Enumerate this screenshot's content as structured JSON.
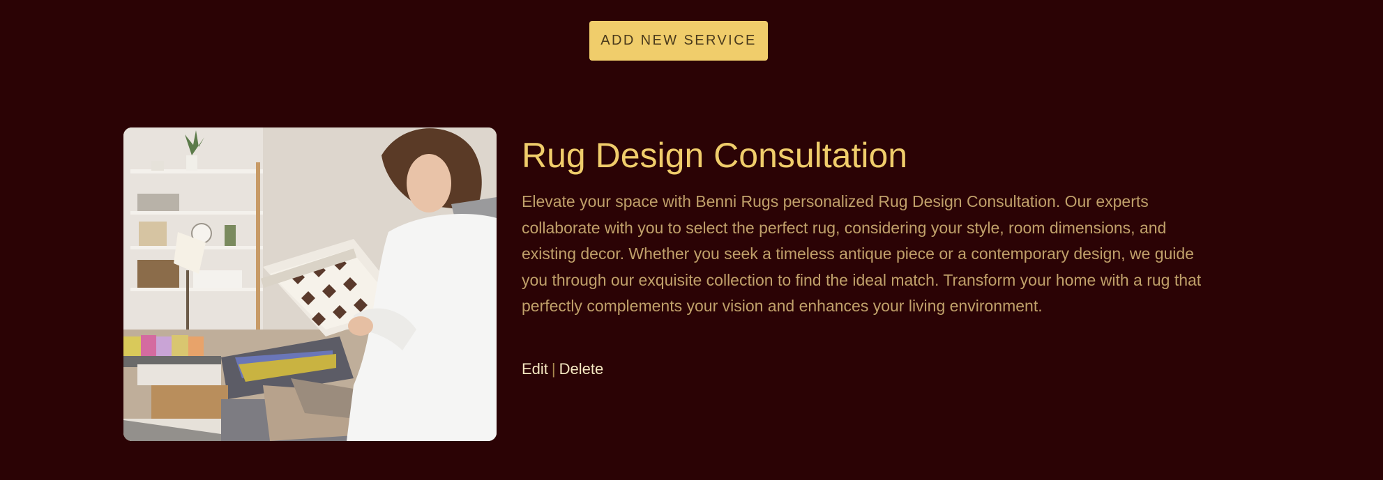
{
  "toolbar": {
    "add_service_label": "ADD NEW SERVICE"
  },
  "services": [
    {
      "title": "Rug Design Consultation",
      "description": "Elevate your space with Benni Rugs personalized Rug Design Consultation. Our experts collaborate with you to select the perfect rug, considering your style, room dimensions, and existing decor. Whether you seek a timeless antique piece or a contemporary design, we guide you through our exquisite collection to find the ideal match. Transform your home with a rug that perfectly complements your vision and enhances your living environment.",
      "edit_label": "Edit",
      "separator": "|",
      "delete_label": "Delete"
    }
  ],
  "colors": {
    "background": "#2b0305",
    "accent": "#f0cd6b",
    "body_text": "#c0a06a"
  }
}
